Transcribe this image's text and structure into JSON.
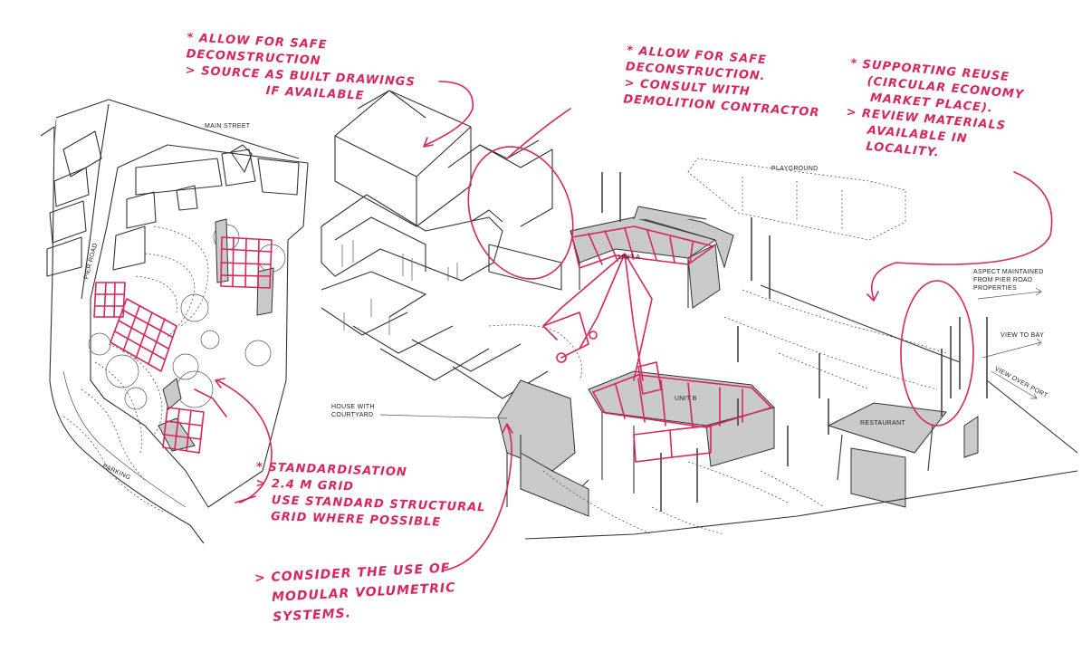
{
  "annotations": {
    "safe_deconstruction_left": {
      "lines": [
        "* Allow for safe",
        "Deconstruction",
        "> Source As built drawings",
        "If available"
      ]
    },
    "safe_deconstruction_center": {
      "lines": [
        "* Allow for safe",
        "Deconstruction.",
        "> Consult with",
        "Demolition contractor"
      ]
    },
    "supporting_reuse": {
      "lines": [
        "* Supporting reuse",
        "(Circular economy",
        "market place).",
        "> Review materials",
        "available in",
        "locality."
      ]
    },
    "standardisation": {
      "lines": [
        "* Standardisation",
        "> 2.4 m grid",
        "Use standard structural",
        "grid where possible"
      ]
    },
    "modular": {
      "lines": [
        "> Consider the use of",
        "modular volumetric",
        "systems."
      ]
    }
  },
  "site_labels": {
    "main_street": "MAIN STREET",
    "pier_road": "PIER ROAD",
    "parking": "PARKING",
    "playground": "PLAYGROUND",
    "unit_a": "UNIT A",
    "unit_b": "UNIT B",
    "restaurant": "RESTAURANT",
    "house_with_courtyard": [
      "HOUSE WITH",
      "COURTYARD"
    ],
    "aspect": [
      "ASPECT MAINTAINED",
      "FROM PIER ROAD",
      "PROPERTIES"
    ],
    "view_to_bay": "VIEW TO BAY",
    "view_over_port": "VIEW OVER PORT"
  },
  "colors": {
    "annotation_ink": "#d6275c",
    "sketch_ink": "#333333",
    "building_fill": "#c9c9c9"
  }
}
